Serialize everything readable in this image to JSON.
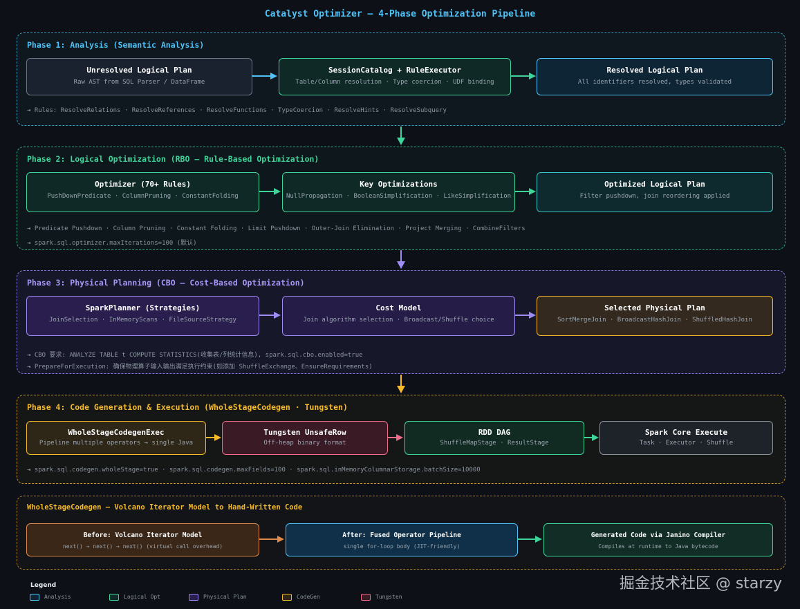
{
  "title": "Catalyst Optimizer — 4-Phase Optimization Pipeline",
  "colors": {
    "analysis": "#4fc3f7",
    "logical": "#3fd49a",
    "physical": "#9f8cf5",
    "codegen": "#f5b92a",
    "tungsten": "#ef6b8a"
  },
  "phase1": {
    "title": "Phase 1: Analysis (Semantic Analysis)",
    "box1": {
      "title": "Unresolved Logical Plan",
      "sub": "Raw AST from SQL Parser / DataFrame"
    },
    "box2": {
      "title": "SessionCatalog + RuleExecutor",
      "sub": "Table/Column resolution · Type coercion · UDF binding"
    },
    "box3": {
      "title": "Resolved Logical Plan",
      "sub": "All identifiers resolved, types validated"
    },
    "note1": "⇥ Rules: ResolveRelations · ResolveReferences · ResolveFunctions · TypeCoercion · ResolveHints · ResolveSubquery"
  },
  "phase2": {
    "title": "Phase 2: Logical Optimization (RBO — Rule-Based Optimization)",
    "box1": {
      "title": "Optimizer (70+ Rules)",
      "sub": "PushDownPredicate · ColumnPruning · ConstantFolding"
    },
    "box2": {
      "title": "Key Optimizations",
      "sub": "NullPropagation · BooleanSimplification · LikeSimplification"
    },
    "box3": {
      "title": "Optimized Logical Plan",
      "sub": "Filter pushdown, join reordering applied"
    },
    "note1": "⇥ Predicate Pushdown · Column Pruning · Constant Folding · Limit Pushdown · Outer-Join Elimination · Project Merging · CombineFilters",
    "note2": "⇥ spark.sql.optimizer.maxIterations=100 (默认)"
  },
  "phase3": {
    "title": "Phase 3: Physical Planning (CBO — Cost-Based Optimization)",
    "box1": {
      "title": "SparkPlanner (Strategies)",
      "sub": "JoinSelection · InMemoryScans · FileSourceStrategy"
    },
    "box2": {
      "title": "Cost Model",
      "sub": "Join algorithm selection · Broadcast/Shuffle choice"
    },
    "box3": {
      "title": "Selected Physical Plan",
      "sub": "SortMergeJoin · BroadcastHashJoin · ShuffledHashJoin"
    },
    "note1": "⇥ CBO 要求: ANALYZE TABLE t COMPUTE STATISTICS(收集表/列统计信息), spark.sql.cbo.enabled=true",
    "note2": "⇥ PrepareForExecution: 确保物理算子输入输出满足执行约束(如添加 ShuffleExchange、EnsureRequirements)"
  },
  "phase4": {
    "title": "Phase 4: Code Generation & Execution (WholeStageCodegen · Tungsten)",
    "box1": {
      "title": "WholeStageCodegenExec",
      "sub": "Pipeline multiple operators → single Java"
    },
    "box2": {
      "title": "Tungsten UnsafeRow",
      "sub": "Off-heap binary format"
    },
    "box3": {
      "title": "RDD DAG",
      "sub": "ShuffleMapStage · ResultStage"
    },
    "box4": {
      "title": "Spark Core Execute",
      "sub": "Task · Executor · Shuffle"
    },
    "note1": "⇥ spark.sql.codegen.wholeStage=true · spark.sql.codegen.maxFields=100 · spark.sql.inMemoryColumnarStorage.batchSize=10000"
  },
  "wscg": {
    "title": "WholeStageCodegen — Volcano Iterator Model to Hand-Written Code",
    "box1": {
      "title": "Before: Volcano Iterator Model",
      "sub": "next() → next() → next() (virtual call overhead)"
    },
    "box2": {
      "title": "After: Fused Operator Pipeline",
      "sub": "single for-loop body (JIT-friendly)"
    },
    "box3": {
      "title": "Generated Code via Janino Compiler",
      "sub": "Compiles at runtime to Java bytecode"
    }
  },
  "legend": {
    "title": "Legend",
    "items": [
      "Analysis",
      "Logical Opt",
      "Physical Plan",
      "CodeGen",
      "Tungsten"
    ]
  },
  "watermark": "掘金技术社区 @ starzy"
}
